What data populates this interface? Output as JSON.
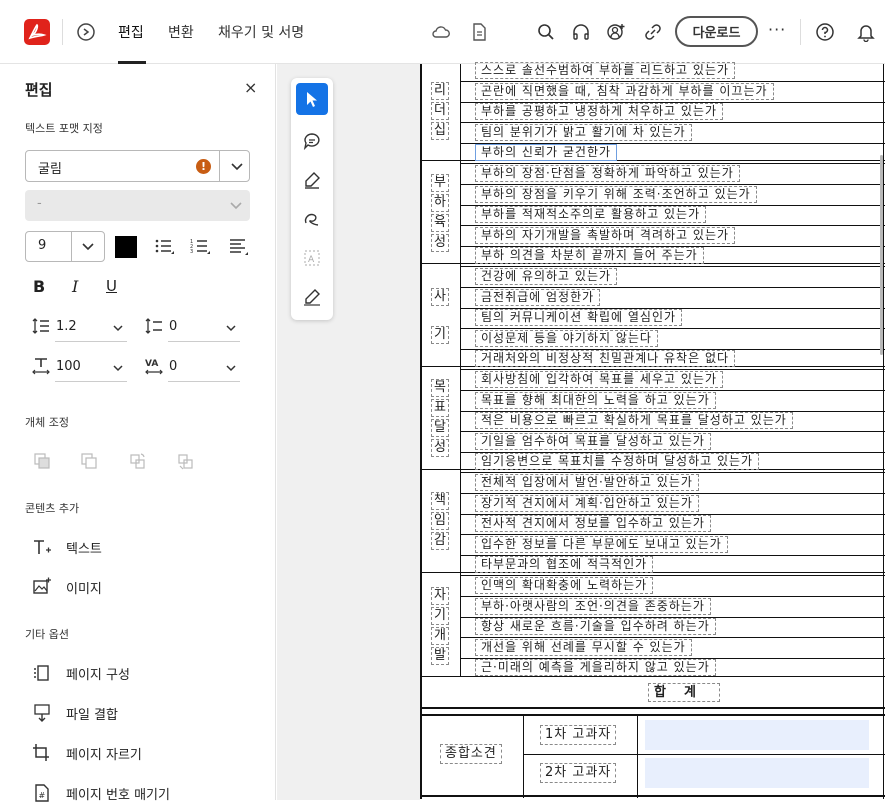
{
  "topbar": {
    "tabs": [
      {
        "label": "편집",
        "active": true
      },
      {
        "label": "변환",
        "active": false
      },
      {
        "label": "채우기 및 서명",
        "active": false
      }
    ],
    "download_label": "다운로드",
    "more_label": "···"
  },
  "panel": {
    "title": "편집",
    "close_label": "×",
    "text_format_label": "텍스트 포맷 지정",
    "font_name": "굴림",
    "font_warning": "!",
    "style_value": "-",
    "font_size": "9",
    "text_color": "#000000",
    "bold_label": "B",
    "italic_label": "I",
    "underline_label": "U",
    "line_spacing": "1.2",
    "paragraph_spacing": "0",
    "horizontal_scale": "100",
    "char_spacing": "0",
    "object_adjust_label": "개체 조정",
    "add_content_label": "콘텐츠 추가",
    "add_text_label": "텍스트",
    "add_image_label": "이미지",
    "other_options_label": "기타 옵션",
    "other_options": [
      {
        "label": "페이지 구성"
      },
      {
        "label": "파일 결합"
      },
      {
        "label": "페이지 자르기"
      },
      {
        "label": "페이지 번호 매기기"
      }
    ]
  },
  "document": {
    "categories": [
      {
        "chars": [
          "리",
          "더",
          "십"
        ]
      },
      {
        "chars": [
          "부",
          "하",
          "육",
          "성"
        ]
      },
      {
        "chars": [
          "사",
          "기"
        ]
      },
      {
        "chars": [
          "목",
          "표",
          "달",
          "성"
        ]
      },
      {
        "chars": [
          "책",
          "임",
          "감"
        ]
      },
      {
        "chars": [
          "자",
          "기",
          "개",
          "발"
        ]
      }
    ],
    "rows": [
      "스스로 솔선수범하여 부하를 리드하고 있는가",
      "곤란에 직면했을 때, 침착 과감하게 부하를 이끄는가",
      "부하를 공평하고 냉정하게 처우하고 있는가",
      "팀의 분위기가 밝고 활기에 차 있는가",
      "부하의 신뢰가 굳건한가",
      "부하의 장점·단점을 정확하게 파악하고 있는가",
      "부하의 장점을 키우기 위해 조력·조언하고 있는가",
      "부하를 적재적소주의로 활용하고 있는가",
      "부하의 자기개발을 촉발하며 격려하고 있는가",
      "부하 의견을 차분히 끝까지 들어 주는가",
      "건강에 유의하고 있는가",
      "금전취급에 엄정한가",
      "팀의 커뮤니케이션 확립에 열심인가",
      "이성문제 등을 야기하지 않는다",
      "거래처와의 비정상적 친밀관계나 유착은 없다",
      "회사방침에 입각하여 목표를 세우고 있는가",
      "목표를 향해 최대한의 노력을 하고 있는가",
      "적은 비용으로 빠르고 확실하게 목표를 달성하고 있는가",
      "기일을 엄수하여 목표를 달성하고 있는가",
      "임기응변으로 목표치를 수정하며 달성하고 있는가",
      "전체적 입장에서 발언·발안하고 있는가",
      "장기적 견지에서 계획·입안하고 있는가",
      "전사적 견지에서 정보를 입수하고 있는가",
      "입수한 정보를 다른 부문에도 보내고 있는가",
      "타부문과의 협조에 적극적인가",
      "인맥의 확대확충에 노력하는가",
      "부하·아랫사람의 조언·의견을 존중하는가",
      "항상 새로운 흐름·기술을 입수하려 하는가",
      "개선을 위해 선례를 무시할 수 있는가",
      "근·미래의 예측을 게을리하지 않고 있는가"
    ],
    "sum_label": "합계",
    "overall_label": "종합소견",
    "reviewer1_label": "1차 고과자",
    "reviewer2_label": "2차 고과자"
  }
}
